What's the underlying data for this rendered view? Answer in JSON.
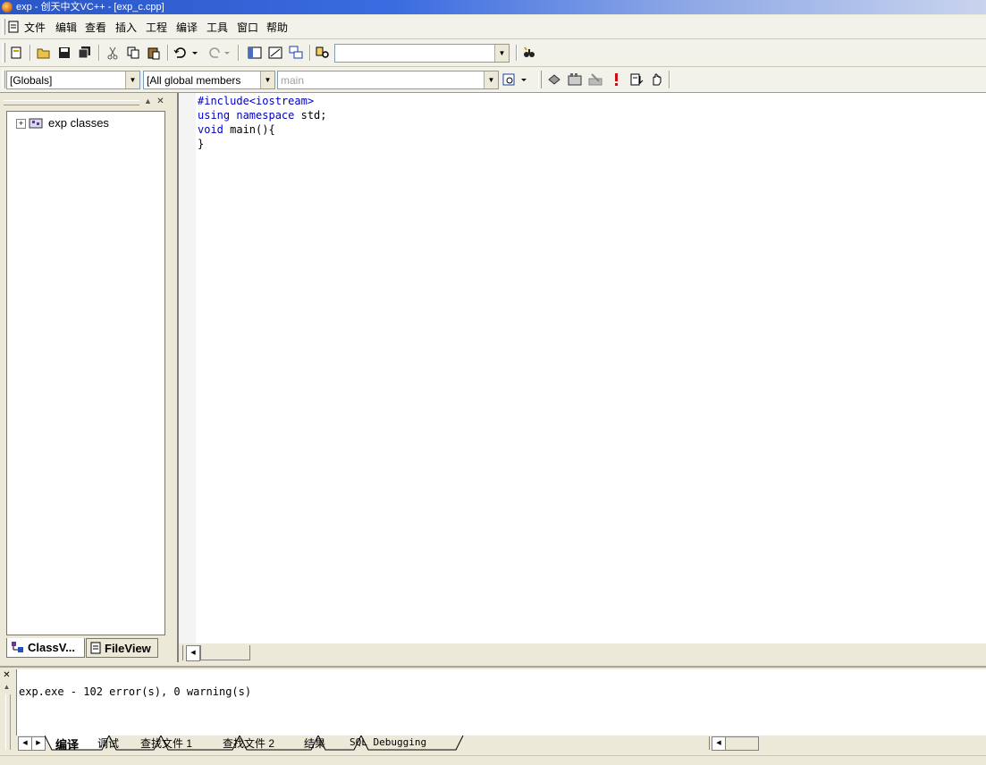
{
  "window": {
    "title": "exp - 创天中文VC++ - [exp_c.cpp]"
  },
  "menu": [
    {
      "label": "文件"
    },
    {
      "label": "编辑"
    },
    {
      "label": "查看"
    },
    {
      "label": "插入"
    },
    {
      "label": "工程"
    },
    {
      "label": "编译"
    },
    {
      "label": "工具"
    },
    {
      "label": "窗口"
    },
    {
      "label": "帮助"
    }
  ],
  "toolbar": {
    "find_combo_value": "",
    "icons": [
      "new-file-icon",
      "open-folder-icon",
      "save-icon",
      "save-all-icon",
      "cut-icon",
      "copy-icon",
      "paste-icon",
      "undo-icon",
      "redo-icon",
      "workspace-icon",
      "output-icon",
      "windows-icon",
      "find-in-files-icon",
      "find-icon"
    ]
  },
  "wizardbar": {
    "class_combo": "[Globals]",
    "filter_combo": "[All global members",
    "members_combo": "main",
    "icons": [
      "wizard-action-icon",
      "compile-icon",
      "build-icon",
      "stop-build-icon",
      "execute-icon",
      "go-icon",
      "breakpoint-icon"
    ]
  },
  "workspace": {
    "tree_root": "exp classes",
    "tabs": [
      {
        "label": "ClassV..."
      },
      {
        "label": "FileView"
      }
    ]
  },
  "editor": {
    "lines": [
      {
        "kw": "",
        "rest": "#include<iostream>"
      },
      {
        "kw": "using namespace",
        "rest": " std;"
      },
      {
        "kw": "void",
        "rest": " main(){"
      },
      {
        "kw": "",
        "rest": "}"
      }
    ]
  },
  "output": {
    "message": "exp.exe - 102 error(s), 0 warning(s)",
    "tabs": [
      {
        "label": "编译"
      },
      {
        "label": "调试"
      },
      {
        "label": "查找文件 1"
      },
      {
        "label": "查找文件 2"
      },
      {
        "label": "结果"
      },
      {
        "label": "SQL Debugging"
      }
    ]
  }
}
